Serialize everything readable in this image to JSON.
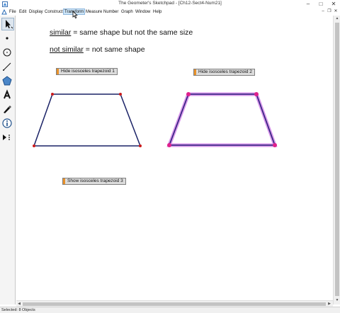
{
  "window": {
    "title": "The Geometer's Sketchpad - [Ch12-Sect4-Num21]",
    "controls": [
      "–",
      "□",
      "✕"
    ]
  },
  "menu": {
    "items": [
      "File",
      "Edit",
      "Display",
      "Construct",
      "Transform",
      "Measure",
      "Number",
      "Graph",
      "Window",
      "Help"
    ],
    "active": "Transform",
    "doc_controls": [
      "–",
      "❐",
      "✕"
    ]
  },
  "toolbar": {
    "tools": [
      "arrow-select-tool",
      "point-tool",
      "compass-tool",
      "straightedge-tool",
      "polygon-tool",
      "text-tool",
      "marker-tool",
      "information-tool",
      "custom-tool"
    ],
    "selected": "arrow-select-tool"
  },
  "sketch": {
    "line1": {
      "term": "similar",
      "rest": " = same shape but not the same size"
    },
    "line2": {
      "term": "not similar",
      "rest": " = not same shape"
    },
    "buttons": {
      "hide1": "Hide isosceles trapezoid 1",
      "hide2": "Hide isosceles trapezoid 2",
      "show3": "Show isosceles trapezoid 3"
    },
    "colors": {
      "trap1_stroke": "#1a2266",
      "trap1_points": "#cc1a1a",
      "trap2_stroke": "#2a1e7a",
      "trap2_highlight": "#c466e0",
      "trap2_points": "#e0208c"
    }
  },
  "status": {
    "text": "Selected: 8 Objects"
  }
}
